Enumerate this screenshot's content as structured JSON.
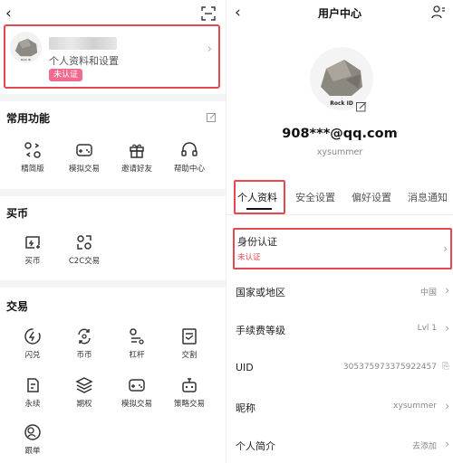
{
  "left": {
    "profile": {
      "subtitle": "个人资料和设置",
      "badge": "未认证"
    },
    "sections": [
      {
        "title": "常用功能",
        "items": [
          {
            "label": "精简版",
            "icon": "lite-mode-icon"
          },
          {
            "label": "模拟交易",
            "icon": "gamepad-icon"
          },
          {
            "label": "邀请好友",
            "icon": "gift-icon"
          },
          {
            "label": "帮助中心",
            "icon": "headset-icon"
          }
        ]
      },
      {
        "title": "买币",
        "items": [
          {
            "label": "买币",
            "icon": "buy-coin-icon"
          },
          {
            "label": "C2C交易",
            "icon": "c2c-icon"
          }
        ]
      },
      {
        "title": "交易",
        "items": [
          {
            "label": "闪兑",
            "icon": "flash-swap-icon"
          },
          {
            "label": "币币",
            "icon": "coin-swap-icon"
          },
          {
            "label": "杠杆",
            "icon": "leverage-icon"
          },
          {
            "label": "交割",
            "icon": "delivery-icon"
          },
          {
            "label": "永续",
            "icon": "perpetual-icon"
          },
          {
            "label": "期权",
            "icon": "options-icon"
          },
          {
            "label": "模拟交易",
            "icon": "gamepad-icon"
          },
          {
            "label": "策略交易",
            "icon": "strategy-icon"
          },
          {
            "label": "跟单",
            "icon": "copy-trade-icon"
          }
        ]
      }
    ]
  },
  "right": {
    "title": "用户中心",
    "email": "908***@qq.com",
    "username": "xysummer",
    "avatar_caption": "Rock ID",
    "tabs": [
      "个人资料",
      "安全设置",
      "偏好设置",
      "消息通知"
    ],
    "identity": {
      "label": "身份认证",
      "status": "未认证"
    },
    "rows": [
      {
        "label": "国家或地区",
        "value": "中国"
      },
      {
        "label": "手续费等级",
        "value": "Lvl 1"
      },
      {
        "label": "UID",
        "value": "305375973375922457"
      },
      {
        "label": "昵称",
        "value": "xysummer"
      },
      {
        "label": "个人简介",
        "value": "去添加"
      }
    ]
  },
  "colors": {
    "highlight": "#e5484d",
    "badge": "#ef6c8f",
    "section_bg": "#f3f4f6"
  }
}
